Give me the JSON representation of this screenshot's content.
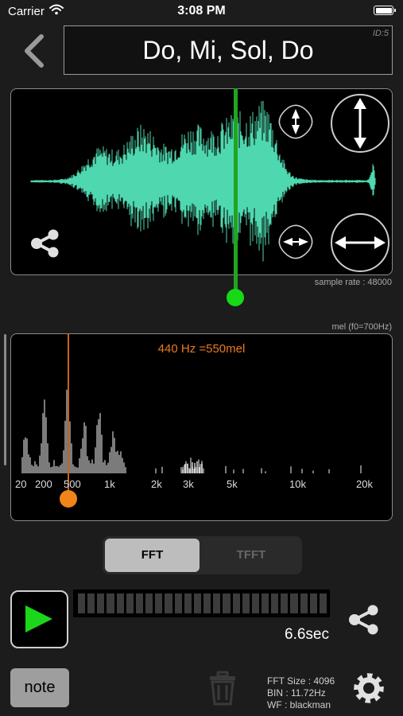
{
  "status_bar": {
    "carrier": "Carrier",
    "time": "3:08 PM"
  },
  "header": {
    "title": "Do, Mi, Sol, Do",
    "id_label": "ID:5"
  },
  "waveform": {
    "sample_rate_label": "sample rate : 48000",
    "cursor_position": 0.54
  },
  "spectrum": {
    "scale_label": "mel (f0=700Hz)",
    "readout": "440 Hz  =550mel",
    "freq_ticks": [
      "20",
      "200",
      "500",
      "1k",
      "2k",
      "3k",
      "5k",
      "10k",
      "20k"
    ]
  },
  "mode_toggle": {
    "options": [
      "FFT",
      "TFFT"
    ],
    "selected": "FFT"
  },
  "playback": {
    "duration": "6.6sec"
  },
  "bottom_bar": {
    "note_label": "note",
    "fft_size": "FFT Size : 4096",
    "bin": "BIN : 11.72Hz",
    "window_fn": "WF : blackman"
  },
  "colors": {
    "waveform": "#4fd8b0",
    "cursor": "#1fa51f",
    "frequency_marker": "#f08418",
    "spectrum": "#9a9a9a"
  }
}
